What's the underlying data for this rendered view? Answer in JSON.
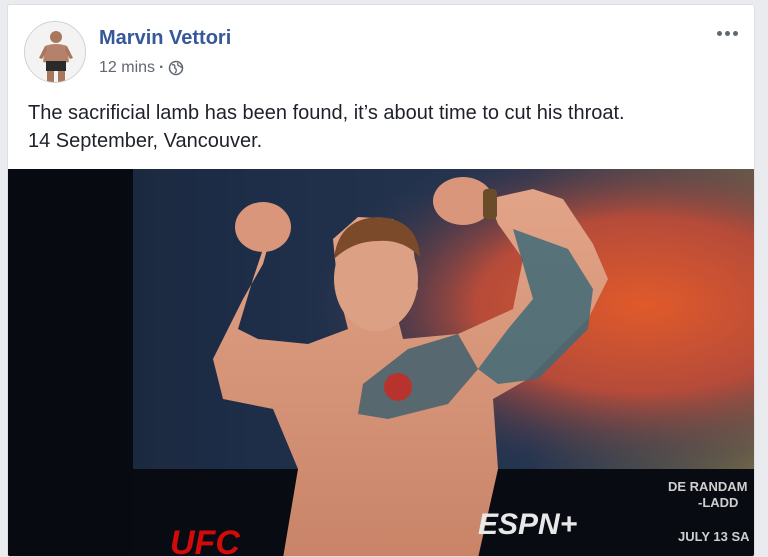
{
  "post": {
    "author": "Marvin Vettori",
    "timestamp": "12 mins",
    "separator": "·",
    "audience_icon": "globe-icon",
    "more_icon": "more-options-icon",
    "text_line1": "The sacrificial lamb has been found, it’s about time to cut his throat.",
    "text_line2": "14 September, Vancouver."
  },
  "photo": {
    "background_sponsors": [
      "UFC",
      "ESPN+"
    ],
    "backdrop_text_1": "DE RANDAM",
    "backdrop_text_2": "-LADD",
    "backdrop_text_3": "JULY 13 SA",
    "ufc": "UFC",
    "espn": "ESPN+"
  },
  "colors": {
    "author_link": "#365899",
    "meta_gray": "#616770",
    "body_text": "#1d2129",
    "ufc_red": "#d20a0a"
  }
}
